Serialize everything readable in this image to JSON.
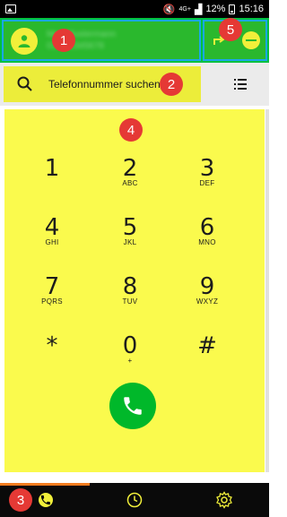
{
  "status_bar": {
    "network": "4G+",
    "battery": "12%",
    "time": "15:16"
  },
  "header": {
    "contact_name": "Max Mustermann",
    "contact_number": "0171 2345678"
  },
  "badges": {
    "b1": "1",
    "b2": "2",
    "b3": "3",
    "b4": "4",
    "b5": "5"
  },
  "search": {
    "placeholder": "Telefonnummer suchen"
  },
  "dialpad": {
    "keys": [
      {
        "digit": "1",
        "letters": ""
      },
      {
        "digit": "2",
        "letters": "ABC"
      },
      {
        "digit": "3",
        "letters": "DEF"
      },
      {
        "digit": "4",
        "letters": "GHI"
      },
      {
        "digit": "5",
        "letters": "JKL"
      },
      {
        "digit": "6",
        "letters": "MNO"
      },
      {
        "digit": "7",
        "letters": "PQRS"
      },
      {
        "digit": "8",
        "letters": "TUV"
      },
      {
        "digit": "9",
        "letters": "WXYZ"
      },
      {
        "digit": "*",
        "letters": ""
      },
      {
        "digit": "0",
        "letters": "+"
      },
      {
        "digit": "#",
        "letters": ""
      }
    ]
  },
  "colors": {
    "header_green": "#00c040",
    "accent_yellow": "#fafa4d",
    "call_green": "#00b82a",
    "badge_red": "#e53935",
    "highlight_blue": "#1aa7e8"
  },
  "icons": {
    "search": "search-icon",
    "list": "list-icon",
    "forward": "forward-icon",
    "minus": "minus-icon",
    "call": "phone-icon",
    "history": "clock-icon",
    "settings": "gear-icon"
  }
}
